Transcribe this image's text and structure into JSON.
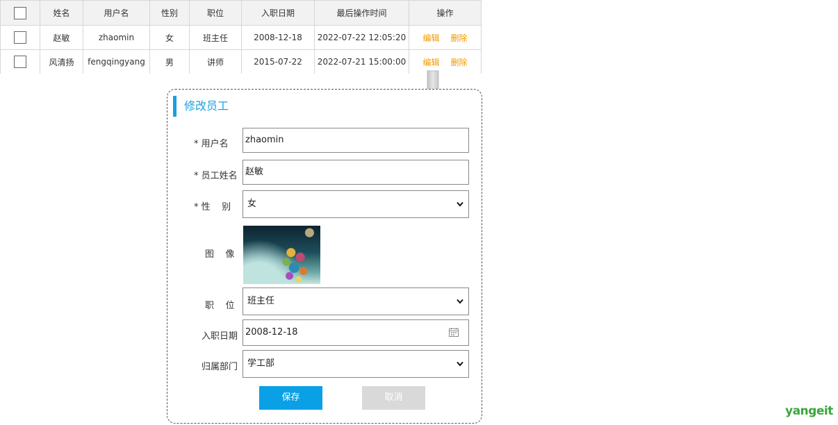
{
  "table": {
    "headers": [
      "姓名",
      "用户名",
      "性别",
      "职位",
      "入职日期",
      "最后操作时间",
      "操作"
    ],
    "rows": [
      {
        "name": "赵敏",
        "username": "zhaomin",
        "gender": "女",
        "position": "班主任",
        "hire_date": "2008-12-18",
        "last_op": "2022-07-22 12:05:20"
      },
      {
        "name": "风清扬",
        "username": "fengqingyang",
        "gender": "男",
        "position": "讲师",
        "hire_date": "2015-07-22",
        "last_op": "2022-07-21 15:00:00"
      }
    ],
    "edit_label": "编辑",
    "delete_label": "删除"
  },
  "dialog": {
    "title": "修改员工",
    "labels": {
      "username": "* 用户名",
      "name": "* 员工姓名",
      "gender": "* 性    别",
      "image": "图    像",
      "position": "职    位",
      "hire_date": "入职日期",
      "department": "归属部门"
    },
    "values": {
      "username": "zhaomin",
      "name": "赵敏",
      "gender": "女",
      "position": "班主任",
      "hire_date": "2008-12-18",
      "department": "学工部"
    },
    "save_label": "保存",
    "cancel_label": "取消"
  },
  "brand": "yangeit",
  "colors": {
    "accent": "#1aa0e0",
    "save_button": "#0aa0e6",
    "action_link": "#f39800",
    "brand": "#3aa53a"
  }
}
